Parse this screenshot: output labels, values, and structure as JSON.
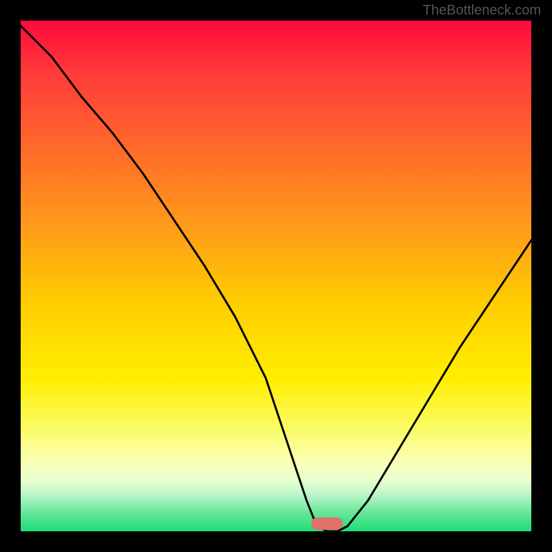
{
  "watermark": "TheBottleneck.com",
  "chart_data": {
    "type": "line",
    "title": "",
    "xlabel": "",
    "ylabel": "",
    "x_range": [
      0,
      100
    ],
    "y_range": [
      0,
      100
    ],
    "x": [
      0,
      6,
      12,
      18,
      24,
      30,
      36,
      42,
      48,
      52,
      56,
      58,
      60,
      62,
      64,
      68,
      74,
      80,
      86,
      92,
      100
    ],
    "values": [
      99,
      93,
      85,
      78,
      70,
      61,
      52,
      42,
      30,
      18,
      6,
      1,
      0,
      0,
      1,
      6,
      16,
      26,
      36,
      45,
      57
    ],
    "marker_x": 60,
    "marker_y": 0,
    "background_gradient": {
      "top": "#ff0a3c",
      "mid": "#ffee00",
      "bottom": "#1cdc78"
    },
    "note": "V-shaped bottleneck curve; minimum (best match) around x≈60 with marker shown at the trough. Axes are unlabeled in the source image."
  }
}
